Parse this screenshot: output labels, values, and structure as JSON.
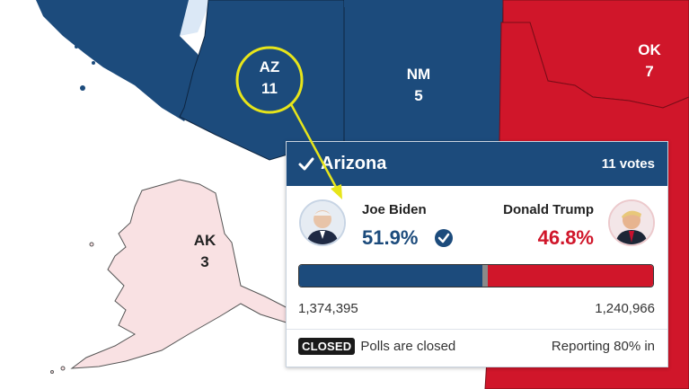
{
  "colors": {
    "dem": "#1c4b7c",
    "rep": "#d0162a",
    "gop_light": "#f9e1e3",
    "highlight": "#e7e51a"
  },
  "map": {
    "states": [
      {
        "abbr": "AZ",
        "ev": "11"
      },
      {
        "abbr": "NM",
        "ev": "5"
      },
      {
        "abbr": "OK",
        "ev": "7"
      },
      {
        "abbr": "AK",
        "ev": "3"
      }
    ]
  },
  "popup": {
    "state_name": "Arizona",
    "votes_label": "11 votes",
    "check_icon": "check-icon",
    "candidates": [
      {
        "name": "Joe Biden",
        "pct": "51.9%",
        "votes": "1,374,395",
        "party": "dem",
        "winner": true,
        "avatar_icon": "biden-portrait-icon"
      },
      {
        "name": "Donald Trump",
        "pct": "46.8%",
        "votes": "1,240,966",
        "party": "rep",
        "winner": false,
        "avatar_icon": "trump-portrait-icon"
      }
    ],
    "bar_share": {
      "dem": 0.519,
      "other": 0.013,
      "rep": 0.468
    },
    "status_badge": "CLOSED",
    "status_text": "Polls are closed",
    "reporting": "Reporting 80% in"
  }
}
